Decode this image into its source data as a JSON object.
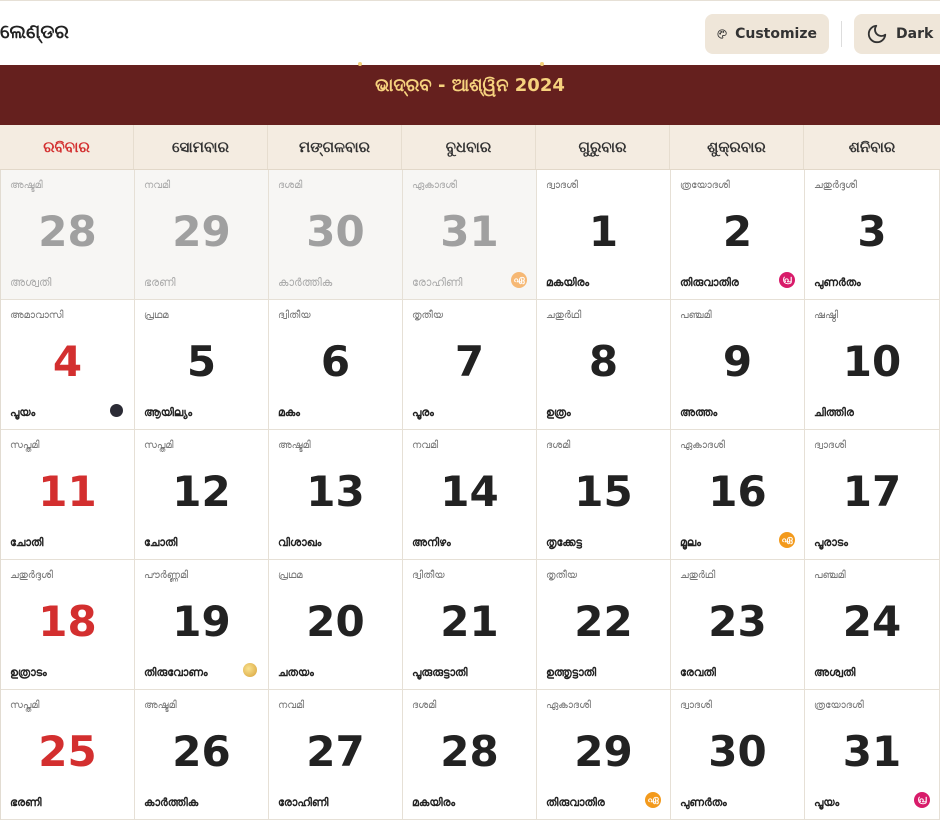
{
  "header": {
    "app_title": "ଲେଣ୍ଡର",
    "customize_label": "Customize",
    "dark_label": "Dark",
    "customize_icon": "palette-icon",
    "dark_icon": "moon-icon"
  },
  "calendar": {
    "title": "ଭାଦ୍ରବ - ଆଶ୍ୱିନ 2024",
    "weekdays": [
      "ରବିବାର",
      "ସୋମବାର",
      "ମଙ୍ଗଳବାର",
      "ବୁଧବାର",
      "ଗୁରୁବାର",
      "ଶୁକ୍ରବାର",
      "ଶନିବାର"
    ],
    "weeks": [
      [
        {
          "tithi": "അഷ്ടമി",
          "day": "28",
          "star": "അശ്വതി",
          "other": true
        },
        {
          "tithi": "നവമി",
          "day": "29",
          "star": "ഭരണി",
          "other": true
        },
        {
          "tithi": "ദശമി",
          "day": "30",
          "star": "കാർത്തിക",
          "other": true
        },
        {
          "tithi": "ഏകാദശി",
          "day": "31",
          "star": "രോഹിണി",
          "other": true,
          "badge": "ഏ",
          "badge_type": "orange-light"
        },
        {
          "tithi": "ദ്വാദശി",
          "day": "1",
          "star": "മകയിരം"
        },
        {
          "tithi": "ത്രയോദശി",
          "day": "2",
          "star": "തിരുവാതിര",
          "badge": "പ്ര",
          "badge_type": "pink"
        },
        {
          "tithi": "ചതുർദ്ദശി",
          "day": "3",
          "star": "പുണർതം"
        }
      ],
      [
        {
          "tithi": "അമാവാസി",
          "day": "4",
          "star": "പൂയം",
          "badge_type": "newmoon"
        },
        {
          "tithi": "പ്രഥമ",
          "day": "5",
          "star": "ആയില്യം"
        },
        {
          "tithi": "ദ്വിതീയ",
          "day": "6",
          "star": "മകം"
        },
        {
          "tithi": "തൃതീയ",
          "day": "7",
          "star": "പൂരം"
        },
        {
          "tithi": "ചതുർഥി",
          "day": "8",
          "star": "ഉത്രം"
        },
        {
          "tithi": "പഞ്ചമി",
          "day": "9",
          "star": "അത്തം"
        },
        {
          "tithi": "ഷഷ്ഠി",
          "day": "10",
          "star": "ചിത്തിര"
        }
      ],
      [
        {
          "tithi": "സപ്തമി",
          "day": "11",
          "star": "ചോതി"
        },
        {
          "tithi": "സപ്തമി",
          "day": "12",
          "star": "ചോതി"
        },
        {
          "tithi": "അഷ്ടമി",
          "day": "13",
          "star": "വിശാഖം"
        },
        {
          "tithi": "നവമി",
          "day": "14",
          "star": "അനിഴം"
        },
        {
          "tithi": "ദശമി",
          "day": "15",
          "star": "തൃക്കേട്ട"
        },
        {
          "tithi": "ഏകാദശി",
          "day": "16",
          "star": "മൂലം",
          "badge": "ഏ",
          "badge_type": "orange"
        },
        {
          "tithi": "ദ്വാദശി",
          "day": "17",
          "star": "പൂരാടം"
        }
      ],
      [
        {
          "tithi": "ചതുർദ്ദശി",
          "day": "18",
          "star": "ഉത്രാടം"
        },
        {
          "tithi": "പൗർണ്ണമി",
          "day": "19",
          "star": "തിരുവോണം",
          "badge_type": "fullmoon"
        },
        {
          "tithi": "പ്രഥമ",
          "day": "20",
          "star": "ചതയം"
        },
        {
          "tithi": "ദ്വിതീയ",
          "day": "21",
          "star": "പൂരുരുട്ടാതി"
        },
        {
          "tithi": "തൃതീയ",
          "day": "22",
          "star": "ഉത്തൃട്ടാതി"
        },
        {
          "tithi": "ചതുർഥി",
          "day": "23",
          "star": "രേവതി"
        },
        {
          "tithi": "പഞ്ചമി",
          "day": "24",
          "star": "അശ്വതി"
        }
      ],
      [
        {
          "tithi": "സപ്തമി",
          "day": "25",
          "star": "ഭരണി"
        },
        {
          "tithi": "അഷ്ടമി",
          "day": "26",
          "star": "കാർത്തിക"
        },
        {
          "tithi": "നവമി",
          "day": "27",
          "star": "രോഹിണി"
        },
        {
          "tithi": "ദശമി",
          "day": "28",
          "star": "മകയിരം"
        },
        {
          "tithi": "ഏകാദശി",
          "day": "29",
          "star": "തിരുവാതിര",
          "badge": "ഏ",
          "badge_type": "orange"
        },
        {
          "tithi": "ദ്വാദശി",
          "day": "30",
          "star": "പുണർതം"
        },
        {
          "tithi": "ത്രയോദശി",
          "day": "31",
          "star": "പൂയം",
          "badge": "പ്ര",
          "badge_type": "pink"
        }
      ]
    ]
  },
  "colors": {
    "band": "#65201e",
    "band_text": "#f6d27e",
    "sunday": "#d32f2f",
    "weekday_bg": "#f4ece1",
    "button_bg": "#efe6d9"
  }
}
